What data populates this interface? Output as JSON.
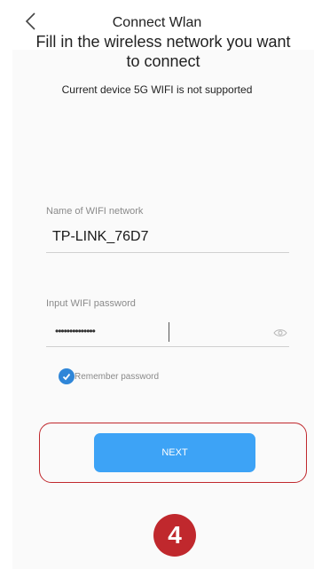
{
  "nav": {
    "title": "Connect Wlan",
    "back_icon": "chevron-left-icon"
  },
  "main": {
    "headline_line1": "Fill in the wireless network you want",
    "headline_line2": "to connect",
    "note": "Current device 5G WIFI is not supported"
  },
  "ssid_field": {
    "label": "Name of WIFI network",
    "value": "TP-LINK_76D7"
  },
  "password_field": {
    "label": "Input WIFI password",
    "masked_value": "••••••••••••••",
    "visibility_icon": "eye-icon"
  },
  "remember": {
    "label": "Remember password",
    "checked": true
  },
  "next_button": {
    "label": "NEXT"
  },
  "step_badge": {
    "number": "4"
  },
  "colors": {
    "accent": "#3da3f6",
    "check": "#2f86d8",
    "highlight": "#c0282d"
  }
}
